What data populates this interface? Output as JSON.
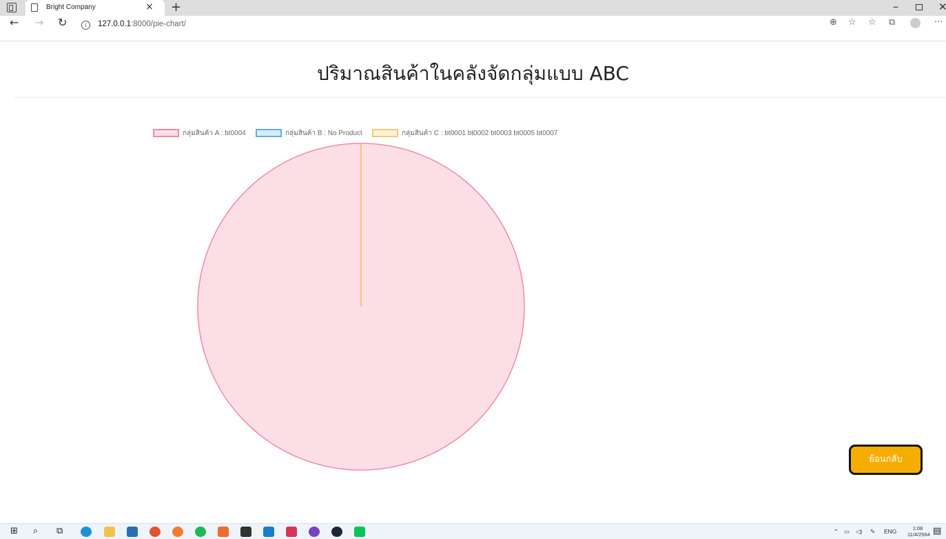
{
  "browser": {
    "tab_title": "Bright Company",
    "url_host": "127.0.0.1",
    "url_rest": ":8000/pie-chart/"
  },
  "page": {
    "title": "ปริมาณสินค้าในคลังจัดกลุ่มแบบ ABC",
    "back_button_label": "ย้อนกลับ"
  },
  "chart_data": {
    "type": "pie",
    "legend_position": "top",
    "categories": [
      "กลุ่มสินค้า A : bt0004",
      "กลุ่มสินค้า B : No Product",
      "กลุ่มสินค้า C : bt0001 bt0002 bt0003 bt0005 bt0007"
    ],
    "values": [
      1,
      0,
      0
    ],
    "colors": {
      "fills": [
        "#fcdfe6",
        "#d7ecfb",
        "#fff3d6"
      ],
      "borders": [
        "#f08aa0",
        "#5fb0e6",
        "#f2c77a"
      ]
    }
  },
  "taskbar": {
    "language": "ENG",
    "time": "1:08",
    "date": "11/4/2564"
  }
}
